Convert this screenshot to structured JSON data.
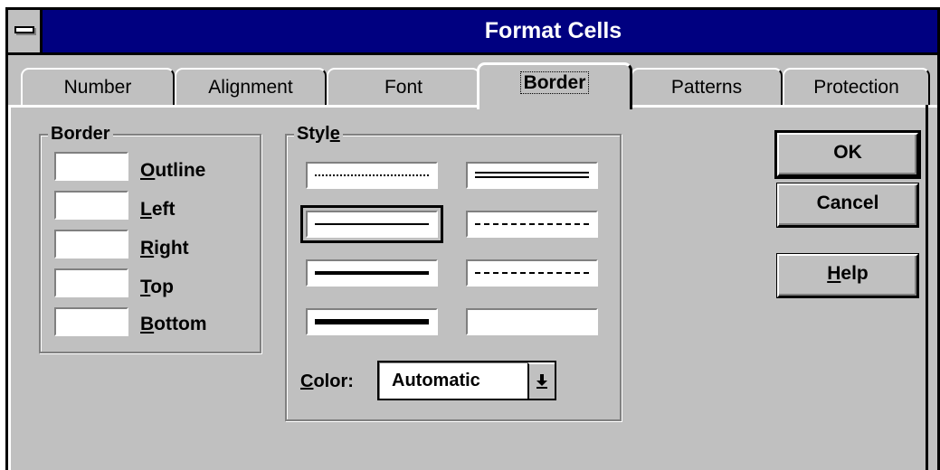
{
  "window": {
    "title": "Format Cells"
  },
  "tabs": [
    {
      "label": "Number"
    },
    {
      "label": "Alignment"
    },
    {
      "label": "Font"
    },
    {
      "label": "Border",
      "active": true
    },
    {
      "label": "Patterns"
    },
    {
      "label": "Protection"
    }
  ],
  "border_group": {
    "title": "Border",
    "items": [
      {
        "prefix": "O",
        "rest": "utline"
      },
      {
        "prefix": "L",
        "rest": "eft"
      },
      {
        "prefix": "R",
        "rest": "ight"
      },
      {
        "prefix": "T",
        "rest": "op"
      },
      {
        "prefix": "B",
        "rest": "ottom"
      }
    ]
  },
  "style_group": {
    "title_start": "Styl",
    "title_mnemonic": "e",
    "selected_style": "thin-solid",
    "styles": [
      "hairline-dotted",
      "double",
      "thin-solid",
      "dashed",
      "medium-solid",
      "dash-dot",
      "thick-solid",
      "none"
    ],
    "color_label_mnemonic": "C",
    "color_label_rest": "olor:",
    "color_value": "Automatic"
  },
  "buttons": {
    "ok": "OK",
    "cancel": "Cancel",
    "help_mnemonic": "H",
    "help_rest": "elp"
  },
  "colors": {
    "title_bar": "#000080",
    "face": "#c0c0c0"
  }
}
